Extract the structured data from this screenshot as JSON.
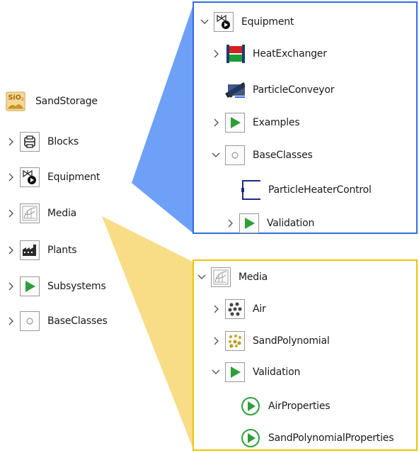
{
  "library": {
    "root": {
      "label": "SandStorage",
      "icon": "sio2-sand-icon"
    },
    "items": [
      {
        "label": "Blocks",
        "icon": "blocks-icon"
      },
      {
        "label": "Equipment",
        "icon": "equipment-valve-pump-icon"
      },
      {
        "label": "Media",
        "icon": "media-diagram-icon"
      },
      {
        "label": "Plants",
        "icon": "factory-icon"
      },
      {
        "label": "Subsystems",
        "icon": "play-triangle-icon"
      },
      {
        "label": "BaseClasses",
        "icon": "base-circle-icon"
      }
    ]
  },
  "equipment_panel": {
    "header": {
      "label": "Equipment"
    },
    "items": [
      {
        "label": "HeatExchanger"
      },
      {
        "label": "ParticleConveyor"
      },
      {
        "label": "Examples"
      },
      {
        "label": "BaseClasses"
      },
      {
        "label": "ParticleHeaterControl"
      },
      {
        "label": "Validation"
      }
    ]
  },
  "media_panel": {
    "header": {
      "label": "Media"
    },
    "items": [
      {
        "label": "Air"
      },
      {
        "label": "SandPolynomial"
      },
      {
        "label": "Validation"
      },
      {
        "label": "AirProperties"
      },
      {
        "label": "SandPolynomialProperties"
      }
    ]
  },
  "colors": {
    "blue_callout": "#6ea0f7",
    "blue_border": "#2f6ee5",
    "yellow_callout": "#f8dc86",
    "yellow_border": "#f2c200",
    "play_green": "#2e9e3a"
  }
}
